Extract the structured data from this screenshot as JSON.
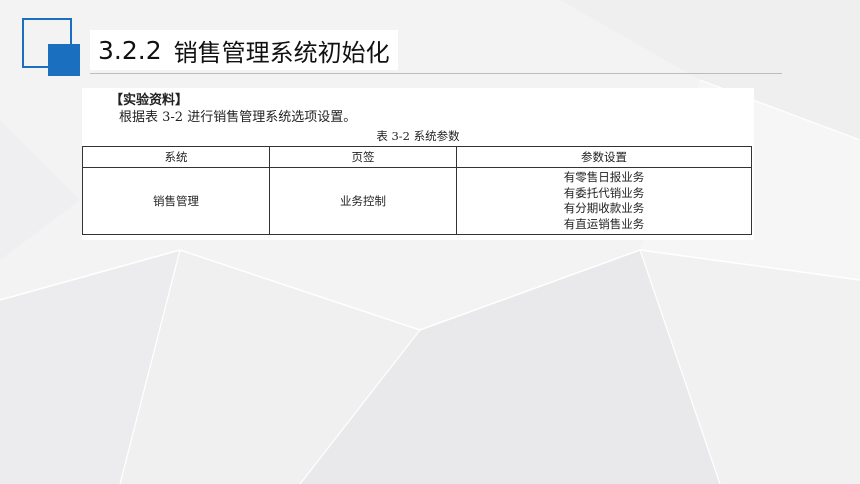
{
  "header": {
    "section_number": "3.2.2",
    "section_title": "销售管理系统初始化"
  },
  "document": {
    "heading": "【实验资料】",
    "intro": "根据表 3-2 进行销售管理系统选项设置。",
    "table_caption": "表 3-2  系统参数",
    "table": {
      "columns": [
        "系统",
        "页签",
        "参数设置"
      ],
      "row": {
        "system": "销售管理",
        "tab": "业务控制",
        "params": [
          "有零售日报业务",
          "有委托代销业务",
          "有分期收款业务",
          "有直运销售业务"
        ]
      }
    }
  },
  "colors": {
    "accent": "#1a6fbf",
    "background": "#f3f3f4"
  }
}
